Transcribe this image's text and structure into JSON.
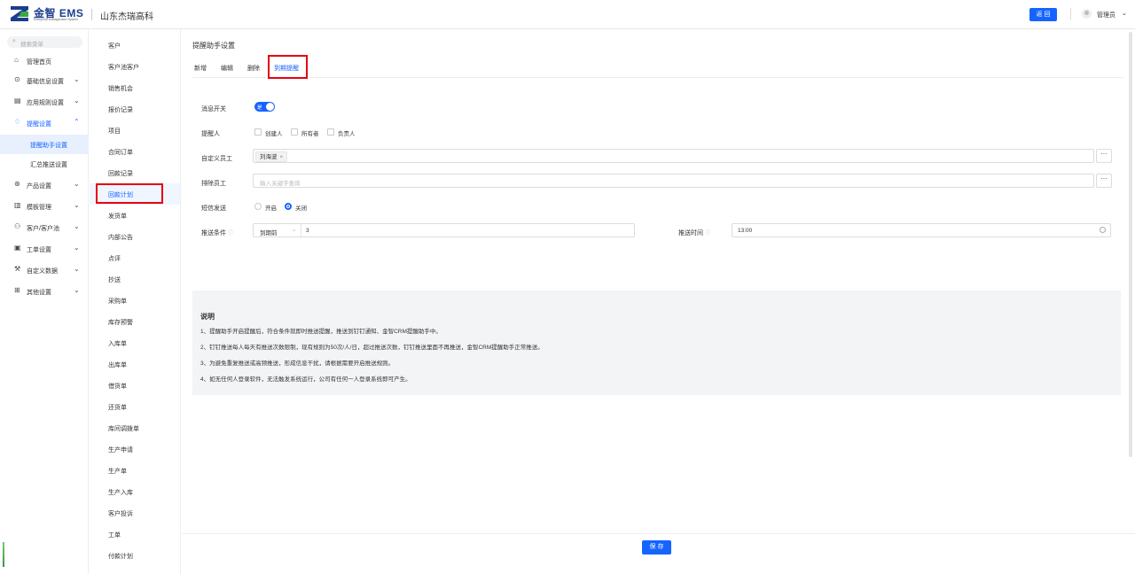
{
  "header": {
    "logo_text": "金智 EMS",
    "logo_sub": "Enterprise Management System",
    "company": "山东杰瑞高科",
    "return_label": "返 回",
    "user_name": "管理员",
    "user_caret": "⌄"
  },
  "leftnav": {
    "search_placeholder": "搜索菜单",
    "items": [
      {
        "label": "管理首页",
        "icon": "home-icon",
        "glyph": "⌂",
        "caret": ""
      },
      {
        "label": "基础信息设置",
        "icon": "settings-circle-icon",
        "glyph": "⊙",
        "caret": "⌄"
      },
      {
        "label": "应用规则设置",
        "icon": "document-icon",
        "glyph": "▤",
        "caret": "⌄"
      },
      {
        "label": "提醒设置",
        "icon": "bell-icon",
        "glyph": "♢",
        "caret": "⌃"
      },
      {
        "label": "产品设置",
        "icon": "product-icon",
        "glyph": "⊛",
        "caret": "⌄"
      },
      {
        "label": "模板管理",
        "icon": "template-icon",
        "glyph": "▥",
        "caret": "⌄"
      },
      {
        "label": "客户/客户池",
        "icon": "customer-icon",
        "glyph": "⚇",
        "caret": "⌄"
      },
      {
        "label": "工单设置",
        "icon": "work-order-icon",
        "glyph": "▣",
        "caret": "⌄"
      },
      {
        "label": "自定义数据",
        "icon": "custom-data-icon",
        "glyph": "⚒",
        "caret": "⌄"
      },
      {
        "label": "其他设置",
        "icon": "grid-icon",
        "glyph": "⊞",
        "caret": "⌄"
      }
    ],
    "sub_items": [
      "提醒助手设置",
      "汇总推送设置"
    ]
  },
  "midlist": {
    "items": [
      "客户",
      "客户池客户",
      "销售机会",
      "报价记录",
      "项目",
      "合同订单",
      "回款记录",
      "回款计划",
      "发货单",
      "内部公告",
      "点评",
      "抄送",
      "采购单",
      "库存预警",
      "入库单",
      "出库单",
      "借货单",
      "还货单",
      "库间调拨单",
      "生产申请",
      "生产单",
      "生产入库",
      "客户投诉",
      "工单",
      "付款计划"
    ]
  },
  "main": {
    "title": "提醒助手设置",
    "tabs": [
      "新增",
      "编辑",
      "删除",
      "到期提醒"
    ],
    "form": {
      "switch_label": "消息开关",
      "switch_text": "是",
      "reminder_label": "提醒人",
      "reminder_options": [
        "创建人",
        "所有者",
        "负责人"
      ],
      "custom_staff_label": "自定义员工",
      "custom_staff_tag": "刘海波",
      "tag_remove": "×",
      "exclude_staff_label": "排除员工",
      "exclude_staff_placeholder": "输入关键字查询",
      "dots": "···",
      "sms_label": "短信发送",
      "sms_options": [
        "开启",
        "关闭"
      ],
      "sms_selected": "关闭",
      "condition_label": "推送条件",
      "condition_select": "到期前",
      "condition_caret": "⌄",
      "condition_value": "3",
      "push_time_label": "推送时间",
      "push_time_value": "13:00",
      "help_glyph": "ⓘ"
    },
    "notes": {
      "title": "说明",
      "lines": [
        "1、提醒助手开启提醒后，符合条件就即时推送提醒，推送到钉钉通知、金智CRM提醒助手中。",
        "2、钉钉推送每人每天有推送次数限制，现有规则为50次/人/日，超过推送次数，钉钉推送里面不再推送，金智CRM提醒助手正常推送。",
        "3、为避免重复推送或高频推送，形成信息干扰，请根据需要开启推送规则。",
        "4、如无任何人登录软件，无法触发系统运行，公司有任何一人登录系统即可产生。"
      ]
    },
    "save_label": "保 存"
  },
  "colors": {
    "accent": "#1664ff",
    "highlight": "#e60012"
  }
}
